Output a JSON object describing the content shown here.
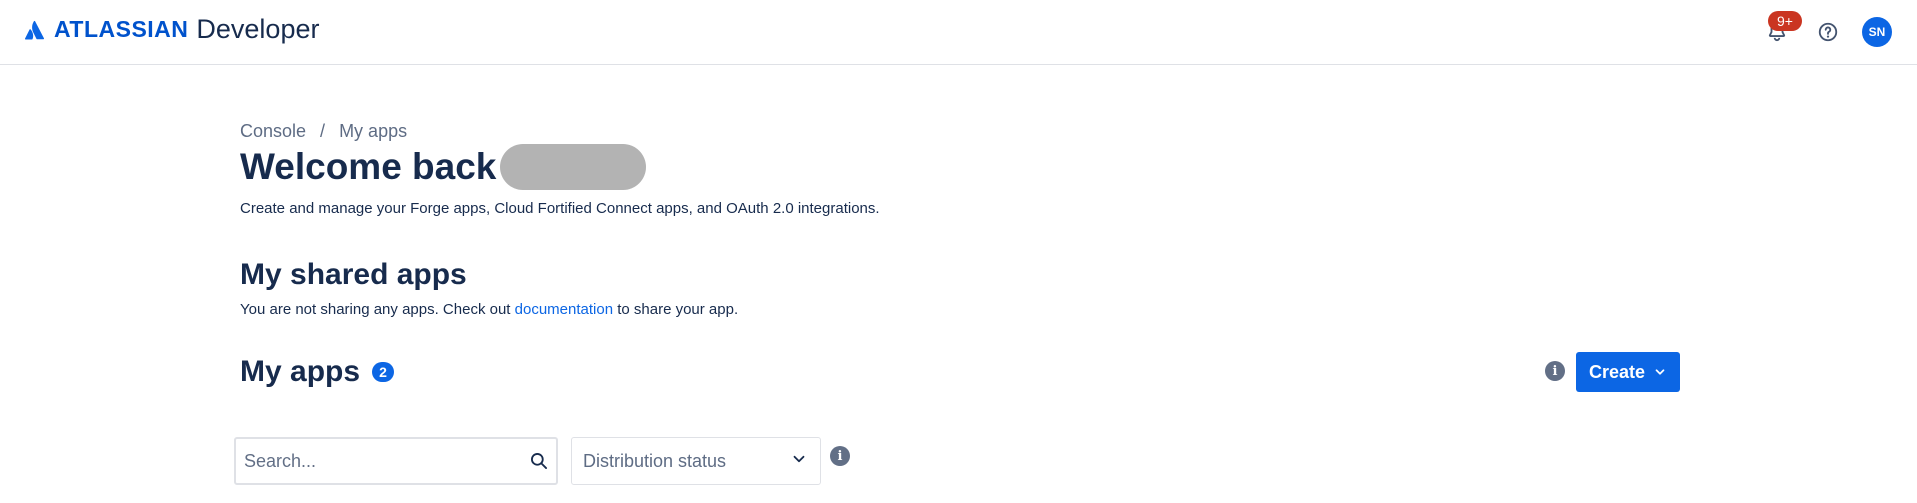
{
  "header": {
    "brand": "ATLASSIAN",
    "product": "Developer",
    "notifications_badge": "9+",
    "avatar_initials": "SN",
    "icons": {
      "logo": "atlassian-logo-icon",
      "notifications": "bell-icon",
      "help": "help-icon"
    },
    "colors": {
      "brand": "#0052cc",
      "badge": "#ca3521",
      "avatar": "#0c66e4"
    }
  },
  "breadcrumb": {
    "items": [
      "Console",
      "My apps"
    ],
    "separator": "/"
  },
  "page": {
    "welcome": "Welcome back",
    "subtitle": "Create and manage your Forge apps, Cloud Fortified Connect apps, and OAuth 2.0 integrations."
  },
  "shared_apps": {
    "title": "My shared apps",
    "text_before": "You are not sharing any apps. Check out ",
    "link": "documentation",
    "text_after": " to share your app."
  },
  "my_apps": {
    "title": "My apps",
    "count": "2",
    "create_label": "Create",
    "info_icon": "info-icon"
  },
  "filters": {
    "search_placeholder": "Search...",
    "distribution_status": "Distribution status"
  }
}
